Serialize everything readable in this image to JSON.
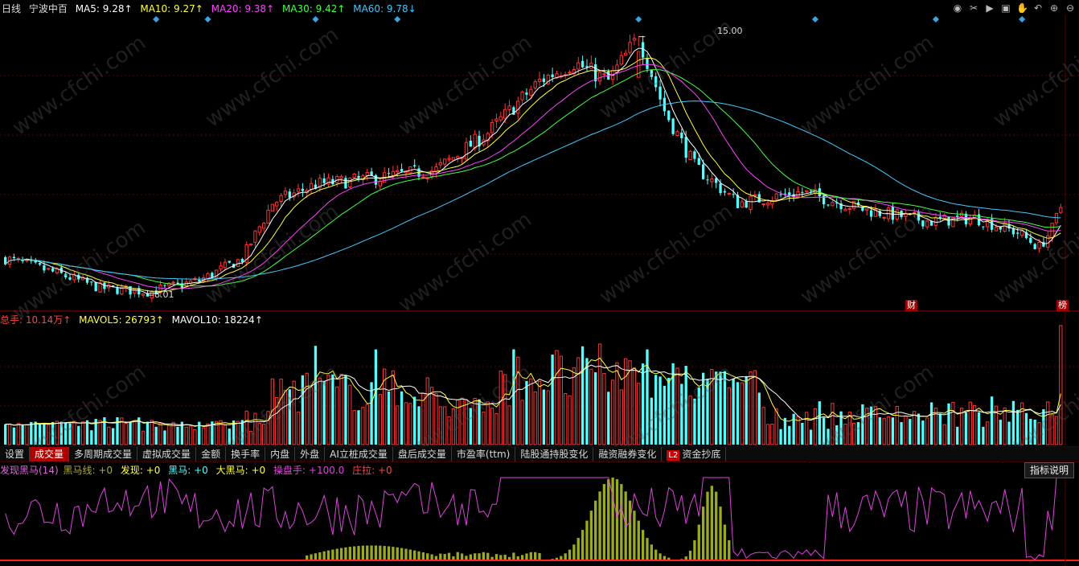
{
  "header": {
    "period": "日线",
    "stock": "宁波中百",
    "ma": [
      {
        "label": "MA5: 9.28↑",
        "color": "#ffffff"
      },
      {
        "label": "MA10: 9.27↑",
        "color": "#ffff44"
      },
      {
        "label": "MA20: 9.38↑",
        "color": "#ff44ff"
      },
      {
        "label": "MA30: 9.42↑",
        "color": "#44ff44"
      },
      {
        "label": "MA60: 9.78↓",
        "color": "#44c8ff"
      }
    ]
  },
  "toolbar_icons": [
    "eye-icon",
    "scissors-icon",
    "play-icon",
    "lock-icon",
    "hand-icon",
    "back-icon",
    "zoom-in-icon",
    "zoom-out-icon"
  ],
  "price_panel": {
    "high_label": "15.00",
    "low_label": "8.01",
    "badges": {
      "fin": "财",
      "bang": "榜"
    }
  },
  "volume_header": {
    "total": "总手: 10.14万↑",
    "mavol5": "MAVOL5: 26793↑",
    "mavol10": "MAVOL10: 18224↑"
  },
  "tabs": [
    {
      "label": "设置",
      "active": false
    },
    {
      "label": "成交量",
      "active": true
    },
    {
      "label": "多周期成交量",
      "active": false
    },
    {
      "label": "虚拟成交量",
      "active": false
    },
    {
      "label": "金额",
      "active": false
    },
    {
      "label": "换手率",
      "active": false
    },
    {
      "label": "内盘",
      "active": false
    },
    {
      "label": "外盘",
      "active": false
    },
    {
      "label": "AI立桩成交量",
      "active": false
    },
    {
      "label": "盘后成交量",
      "active": false
    },
    {
      "label": "市盈率(ttm)",
      "active": false
    },
    {
      "label": "陆股通持股变化",
      "active": false
    },
    {
      "label": "融资融券变化",
      "active": false
    },
    {
      "label": "资金抄底",
      "active": false,
      "l2": "L2"
    }
  ],
  "indicator_header": {
    "name": "发现黑马(14)",
    "line": "黑马线: +0",
    "found": "发现: +0",
    "black": "黑马: +0",
    "big": "大黑马: +0",
    "trader": "操盘手: +100.0",
    "pull": "庄拉: +0"
  },
  "explain_button": "指标说明",
  "watermark": "www.cfchi.com",
  "colors": {
    "up": "#ff3232",
    "down": "#54ffff",
    "grid": "#5a0000",
    "ma5": "#ffffff",
    "ma10": "#ffff44",
    "ma20": "#ff44ff",
    "ma30": "#44ff44",
    "ma60": "#44c8ff",
    "trader_line": "#dd44dd",
    "found_bar": "#9aaa22"
  },
  "chart_data": [
    {
      "type": "candlestick",
      "title": "宁波中百 日线",
      "ylim": [
        7.6,
        15.6
      ],
      "high": 15.0,
      "low": 8.01,
      "series": [
        {
          "name": "MA5",
          "last": 9.28
        },
        {
          "name": "MA10",
          "last": 9.27
        },
        {
          "name": "MA20",
          "last": 9.38
        },
        {
          "name": "MA30",
          "last": 9.42
        },
        {
          "name": "MA60",
          "last": 9.78
        }
      ],
      "control_points": [
        [
          0,
          9.0
        ],
        [
          12,
          8.6
        ],
        [
          22,
          8.2
        ],
        [
          33,
          8.1
        ],
        [
          45,
          8.4
        ],
        [
          55,
          9.0
        ],
        [
          62,
          10.5
        ],
        [
          72,
          11.0
        ],
        [
          88,
          11.2
        ],
        [
          100,
          11.4
        ],
        [
          112,
          12.4
        ],
        [
          124,
          13.8
        ],
        [
          132,
          14.3
        ],
        [
          140,
          13.8
        ],
        [
          147,
          15.0
        ],
        [
          153,
          13.0
        ],
        [
          160,
          11.5
        ],
        [
          170,
          10.5
        ],
        [
          185,
          10.8
        ],
        [
          200,
          10.3
        ],
        [
          215,
          10.0
        ],
        [
          225,
          10.1
        ],
        [
          235,
          9.7
        ],
        [
          240,
          9.3
        ],
        [
          243,
          9.8
        ],
        [
          245,
          10.4
        ]
      ]
    },
    {
      "type": "bar",
      "title": "成交量",
      "series": [
        {
          "name": "总手"
        },
        {
          "name": "MAVOL5",
          "last": 26793
        },
        {
          "name": "MAVOL10",
          "last": 18224
        }
      ],
      "last_volume": "10.14万"
    },
    {
      "type": "line",
      "title": "发现黑马(14)",
      "series": [
        {
          "name": "操盘手",
          "last": 100.0
        },
        {
          "name": "发现"
        },
        {
          "name": "黑马"
        },
        {
          "name": "大黑马"
        },
        {
          "name": "庄拉"
        }
      ],
      "ylim": [
        0,
        100
      ]
    }
  ]
}
